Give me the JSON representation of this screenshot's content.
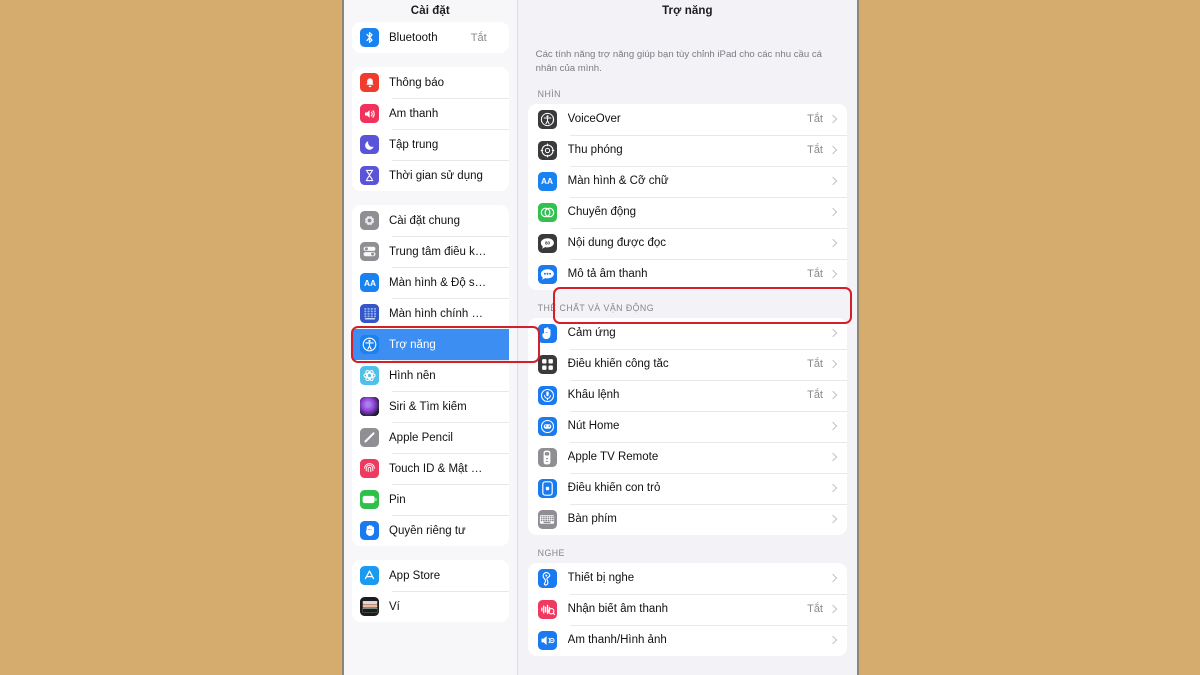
{
  "background_color": "#d5ac6d",
  "accent_selected": "#3d8ef3",
  "annotation_color": "#d2202a",
  "sidebar": {
    "title": "Cài đặt",
    "groups": [
      {
        "items": [
          {
            "label": "Bluetooth",
            "value": "Tắt",
            "icon": "bluetooth-icon",
            "icon_color": "#1a82f0"
          }
        ]
      },
      {
        "items": [
          {
            "label": "Thông báo",
            "value": "",
            "icon": "notifications-icon",
            "icon_color": "#f03b2f"
          },
          {
            "label": "Âm thanh",
            "value": "",
            "icon": "sound-icon",
            "icon_color": "#f0325c"
          },
          {
            "label": "Tập trung",
            "value": "",
            "icon": "focus-moon-icon",
            "icon_color": "#5a54d8"
          },
          {
            "label": "Thời gian sử dụng",
            "value": "",
            "icon": "screen-time-icon",
            "icon_color": "#5a54d8"
          }
        ]
      },
      {
        "items": [
          {
            "label": "Cài đặt chung",
            "value": "",
            "icon": "gear-icon",
            "icon_color": "#8e8e93"
          },
          {
            "label": "Trung tâm điều khiển",
            "value": "",
            "icon": "control-center-icon",
            "icon_color": "#8e8e93"
          },
          {
            "label": "Màn hình & Độ sáng",
            "value": "",
            "icon": "display-aa-icon",
            "icon_color": "#1a82f0"
          },
          {
            "label": "Màn hình chính & Dock",
            "value": "",
            "icon": "home-screen-dock-icon",
            "icon_color": "#3456c8"
          },
          {
            "label": "Trợ năng",
            "value": "",
            "icon": "accessibility-icon",
            "icon_color": "#1a82f0",
            "selected": true,
            "annotated": true
          },
          {
            "label": "Hình nền",
            "value": "",
            "icon": "wallpaper-icon",
            "icon_color": "#4fc0e8"
          },
          {
            "label": "Siri & Tìm kiếm",
            "value": "",
            "icon": "siri-icon",
            "icon_color": "#2b2b38"
          },
          {
            "label": "Apple Pencil",
            "value": "",
            "icon": "apple-pencil-icon",
            "icon_color": "#8e8e93"
          },
          {
            "label": "Touch ID & Mật mã",
            "value": "",
            "icon": "touch-id-icon",
            "icon_color": "#f0395e"
          },
          {
            "label": "Pin",
            "value": "",
            "icon": "battery-icon",
            "icon_color": "#2fc04a"
          },
          {
            "label": "Quyền riêng tư",
            "value": "",
            "icon": "privacy-hand-icon",
            "icon_color": "#1a7af0"
          }
        ]
      },
      {
        "items": [
          {
            "label": "App Store",
            "value": "",
            "icon": "app-store-icon",
            "icon_color": "#1a9af0"
          },
          {
            "label": "Ví",
            "value": "",
            "icon": "wallet-icon",
            "icon_color": "#1c1c1e"
          }
        ]
      }
    ]
  },
  "detail": {
    "title": "Trợ năng",
    "intro": "Các tính năng trợ năng giúp bạn tùy chỉnh iPad cho các nhu cầu cá nhân của mình.",
    "sections": [
      {
        "heading": "NHÌN",
        "items": [
          {
            "label": "VoiceOver",
            "value": "Tắt",
            "icon": "voiceover-icon",
            "icon_color": "#3a3a3c"
          },
          {
            "label": "Thu phóng",
            "value": "Tắt",
            "icon": "zoom-icon",
            "icon_color": "#3a3a3c"
          },
          {
            "label": "Màn hình & Cỡ chữ",
            "value": "",
            "icon": "display-aa-icon",
            "icon_color": "#1a82f0"
          },
          {
            "label": "Chuyển động",
            "value": "",
            "icon": "motion-icon",
            "icon_color": "#30c14e"
          },
          {
            "label": "Nội dung được đọc",
            "value": "",
            "icon": "spoken-content-icon",
            "icon_color": "#3a3a3c"
          },
          {
            "label": "Mô tả âm thanh",
            "value": "Tắt",
            "icon": "audio-description-icon",
            "icon_color": "#1a7af0"
          }
        ]
      },
      {
        "heading": "THỂ CHẤT VÀ VẬN ĐỘNG",
        "items": [
          {
            "label": "Cảm ứng",
            "value": "",
            "icon": "touch-hand-icon",
            "icon_color": "#1a7af0",
            "annotated": true
          },
          {
            "label": "Điều khiển công tắc",
            "value": "Tắt",
            "icon": "switch-control-icon",
            "icon_color": "#3a3a3c"
          },
          {
            "label": "Khẩu lệnh",
            "value": "Tắt",
            "icon": "voice-control-icon",
            "icon_color": "#1a7af0"
          },
          {
            "label": "Nút Home",
            "value": "",
            "icon": "home-button-icon",
            "icon_color": "#1a7af0"
          },
          {
            "label": "Apple TV Remote",
            "value": "",
            "icon": "apple-tv-remote-icon",
            "icon_color": "#8e8e93"
          },
          {
            "label": "Điều khiển con trỏ",
            "value": "",
            "icon": "pointer-control-icon",
            "icon_color": "#1a7af0"
          },
          {
            "label": "Bàn phím",
            "value": "",
            "icon": "keyboard-icon",
            "icon_color": "#8e8e93"
          }
        ]
      },
      {
        "heading": "NGHE",
        "items": [
          {
            "label": "Thiết bị nghe",
            "value": "",
            "icon": "hearing-devices-icon",
            "icon_color": "#1a7af0"
          },
          {
            "label": "Nhận biết âm thanh",
            "value": "Tắt",
            "icon": "sound-recognition-icon",
            "icon_color": "#f0395e"
          },
          {
            "label": "Âm thanh/Hình ảnh",
            "value": "",
            "icon": "audio-visual-icon",
            "icon_color": "#1a7af0"
          }
        ]
      }
    ]
  }
}
